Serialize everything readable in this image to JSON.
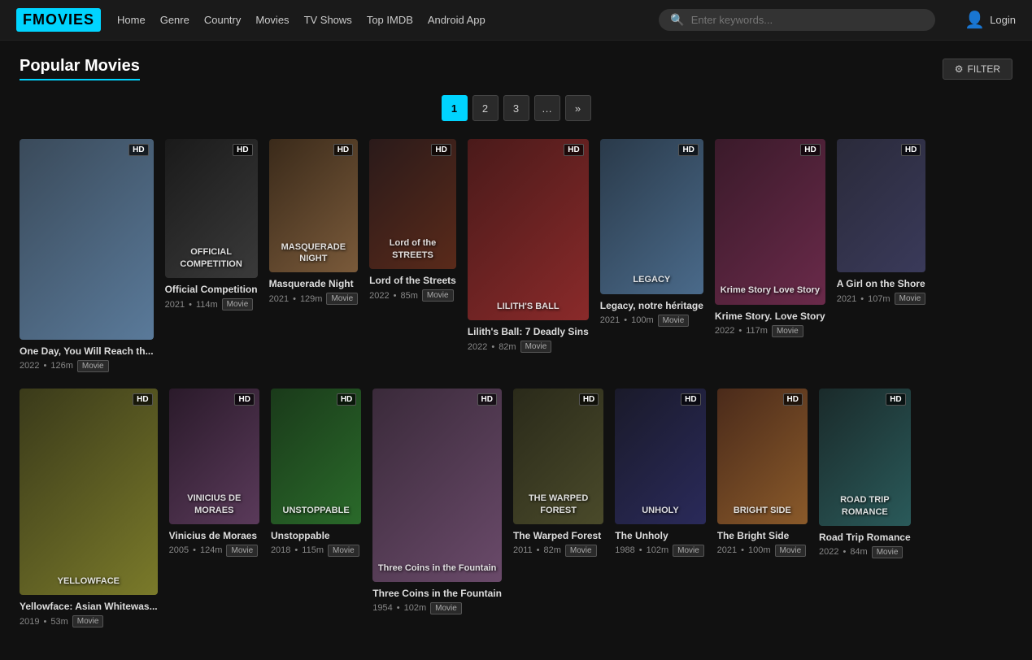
{
  "logo": "FMOVIES",
  "nav": {
    "links": [
      "Home",
      "Genre",
      "Country",
      "Movies",
      "TV Shows",
      "Top IMDB",
      "Android App"
    ]
  },
  "search": {
    "placeholder": "Enter keywords..."
  },
  "login": {
    "label": "Login"
  },
  "header": {
    "title": "Popular Movies",
    "filter_label": "FILTER"
  },
  "pagination": {
    "pages": [
      "1",
      "2",
      "3",
      "…",
      "»"
    ],
    "active": 0
  },
  "movies_row1": [
    {
      "title": "One Day, You Will Reach th...",
      "year": "2022",
      "duration": "126m",
      "tag": "Movie",
      "hd": true,
      "poster_class": "poster-1",
      "poster_text": ""
    },
    {
      "title": "Official Competition",
      "year": "2021",
      "duration": "114m",
      "tag": "Movie",
      "hd": true,
      "poster_class": "poster-2",
      "poster_text": "OFFICIAL COMPETITION"
    },
    {
      "title": "Masquerade Night",
      "year": "2021",
      "duration": "129m",
      "tag": "Movie",
      "hd": true,
      "poster_class": "poster-3",
      "poster_text": "MASQUERADE NIGHT"
    },
    {
      "title": "Lord of the Streets",
      "year": "2022",
      "duration": "85m",
      "tag": "Movie",
      "hd": true,
      "poster_class": "poster-4",
      "poster_text": "Lord of the STREETS"
    },
    {
      "title": "Lilith's Ball: 7 Deadly Sins",
      "year": "2022",
      "duration": "82m",
      "tag": "Movie",
      "hd": true,
      "poster_class": "poster-5",
      "poster_text": "LILITH'S BALL"
    },
    {
      "title": "Legacy, notre héritage",
      "year": "2021",
      "duration": "100m",
      "tag": "Movie",
      "hd": true,
      "poster_class": "poster-6",
      "poster_text": "LEGACY"
    },
    {
      "title": "Krime Story. Love Story",
      "year": "2022",
      "duration": "117m",
      "tag": "Movie",
      "hd": true,
      "poster_class": "poster-7",
      "poster_text": "Krime Story Love Story"
    },
    {
      "title": "A Girl on the Shore",
      "year": "2021",
      "duration": "107m",
      "tag": "Movie",
      "hd": true,
      "poster_class": "poster-8",
      "poster_text": ""
    }
  ],
  "movies_row2": [
    {
      "title": "Yellowface: Asian Whitewas...",
      "year": "2019",
      "duration": "53m",
      "tag": "Movie",
      "hd": true,
      "poster_class": "poster-10",
      "poster_text": "YELLOWFACE"
    },
    {
      "title": "Vinicius de Moraes",
      "year": "2005",
      "duration": "124m",
      "tag": "Movie",
      "hd": true,
      "poster_class": "poster-11",
      "poster_text": "VINICIUS DE MORAES"
    },
    {
      "title": "Unstoppable",
      "year": "2018",
      "duration": "115m",
      "tag": "Movie",
      "hd": true,
      "poster_class": "poster-12",
      "poster_text": "UNSTOPPABLE"
    },
    {
      "title": "Three Coins in the Fountain",
      "year": "1954",
      "duration": "102m",
      "tag": "Movie",
      "hd": true,
      "poster_class": "poster-13",
      "poster_text": "Three Coins in the Fountain"
    },
    {
      "title": "The Warped Forest",
      "year": "2011",
      "duration": "82m",
      "tag": "Movie",
      "hd": true,
      "poster_class": "poster-14",
      "poster_text": "THE WARPED FOREST"
    },
    {
      "title": "The Unholy",
      "year": "1988",
      "duration": "102m",
      "tag": "Movie",
      "hd": true,
      "poster_class": "poster-15",
      "poster_text": "UNHOLY"
    },
    {
      "title": "The Bright Side",
      "year": "2021",
      "duration": "100m",
      "tag": "Movie",
      "hd": true,
      "poster_class": "poster-16",
      "poster_text": "BRIGHT SIDE"
    },
    {
      "title": "Road Trip Romance",
      "year": "2022",
      "duration": "84m",
      "tag": "Movie",
      "hd": true,
      "poster_class": "poster-17",
      "poster_text": "ROAD TRIP ROMANCE"
    }
  ]
}
